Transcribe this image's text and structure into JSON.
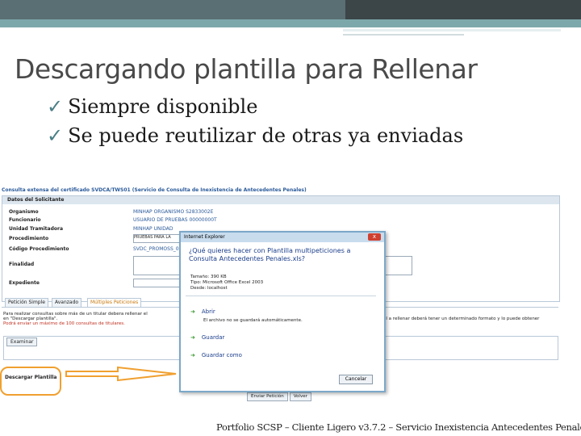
{
  "slide": {
    "title": "Descargando plantilla para Rellenar",
    "bullets": [
      "Siempre disponible",
      "Se puede reutilizar de otras ya enviadas"
    ],
    "check_glyph": "✓",
    "footer": "Portfolio SCSP – Cliente Ligero v3.7.2 – Servicio Inexistencia Antecedentes Penales"
  },
  "app": {
    "title": "Consulta extensa del certificado SVDCA/TWS01 (Servicio de Consulta de Inexistencia de Antecedentes Penales)",
    "section_title": "Datos del Solicitante",
    "rows": [
      {
        "label": "Organismo",
        "value": "MINHAP ORGANISMO   S2833002E"
      },
      {
        "label": "Funcionario",
        "value": "USUARIO DE PRUEBAS   00000000T"
      },
      {
        "label": "Unidad Tramitadora",
        "value": "MINHAP UNIDAD"
      },
      {
        "label": "Procedimiento",
        "value": "PRUEBAS PARA LA"
      },
      {
        "label": "Código Procedimiento",
        "value": "SVDC_PROMOSS_00"
      },
      {
        "label": "Finalidad",
        "value": ""
      },
      {
        "label": "Expediente",
        "value": ""
      }
    ],
    "tabs": [
      "Petición Simple",
      "Avanzado",
      "Múltiples Peticiones"
    ],
    "info_line1": "Para realizar consultas sobre más de un titular debera rellenar el",
    "info_line2": "en \"Descargar plantilla\".",
    "info_line3": "Podrá enviar un máximo de 100 consultas de titulares.",
    "right_text": "cel a rellenar deberá tener un determinado formato y lo puede obtener",
    "examinar": "Examinar",
    "descargar": "Descargar Plantilla",
    "bottom_buttons": [
      "Enviar Petición",
      "Volver"
    ]
  },
  "dialog": {
    "title": "Internet Explorer",
    "close": "x",
    "question": "¿Qué quieres hacer con Plantilla multipeticiones a Consulta Antecedentes Penales.xls?",
    "meta": [
      "Tamaño: 390 KB",
      "Tipo: Microsoft Office Excel 2003",
      "Desde: localhost"
    ],
    "options": [
      "Abrir",
      "Guardar",
      "Guardar como"
    ],
    "open_sub": "El archivo no se guardará automáticamente.",
    "cancel": "Cancelar"
  },
  "colors": {
    "accent": "#f0a030",
    "header": "#5a6f73",
    "teal": "#7da8ab"
  }
}
